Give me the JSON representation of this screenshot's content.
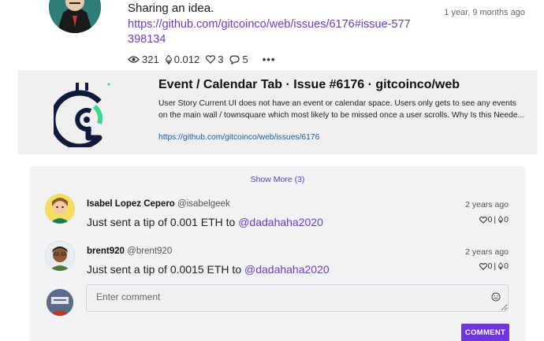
{
  "post": {
    "text": "Sharing an idea.",
    "time": "1 year, 9 months ago",
    "link": "https://github.com/gitcoinco/web/issues/6176#issue-577398134",
    "stats": {
      "views": "321",
      "eth": "0.012",
      "likes": "3",
      "comments": "5"
    },
    "more": "•••"
  },
  "preview": {
    "title": "Event / Calendar Tab · Issue #6176 · gitcoinco/web",
    "description": "User Story Current UI does not have an event or calendar space. Users only gets to see any events on the main wall / townsquare which most likely to be missed once a user scrolls. Why Is this Neede...",
    "url": "https://github.com/gitcoinco/web/issues/6176"
  },
  "comments_panel": {
    "show_more": "Show More (3)",
    "comments": [
      {
        "name": "Isabel Lopez Cepero",
        "handle": "@isabelgeek",
        "time": "2 years ago",
        "body_prefix": "Just sent a tip of 0.001 ETH to ",
        "mention": "@dadahaha2020",
        "likes": "0",
        "tips": "0"
      },
      {
        "name": "brent920",
        "handle": "@brent920",
        "time": "2 years ago",
        "body_prefix": "Just sent a tip of 0.0015 ETH to ",
        "mention": "@dadahaha2020",
        "likes": "0",
        "tips": "0"
      }
    ],
    "input_placeholder": "Enter comment",
    "submit_label": "COMMENT"
  },
  "colors": {
    "link": "#6a3fc8",
    "button": "#6e35e0",
    "brand_green": "#3dd68c",
    "brand_navy": "#0f1a3c"
  }
}
